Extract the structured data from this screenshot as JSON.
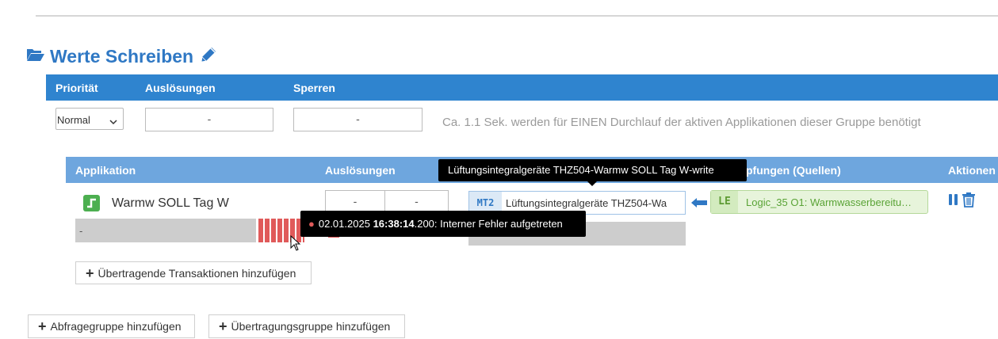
{
  "section": {
    "title": "Werte Schreiben",
    "icon": "folder-open-icon",
    "edit_icon": "pencil-icon"
  },
  "group_header": {
    "prioritaet": "Priorität",
    "ausloesungen": "Auslösungen",
    "sperren": "Sperren"
  },
  "group_values": {
    "priority_selected": "Normal",
    "ausloesungen": "-",
    "sperren": "-",
    "hint": "Ca. 1.1 Sek. werden für EINEN Durchlauf der aktiven Applikationen dieser Gruppe benötigt"
  },
  "app_header": {
    "applikation": "Applikation",
    "ausloesungen": "Auslösungen",
    "verknuepfungen": "pfungen (Quellen)",
    "aktionen": "Aktionen"
  },
  "app_row": {
    "name": "Warmw SOLL Tag W",
    "status_text": "-",
    "trigger_1": "-",
    "trigger_2": "-",
    "target_badge": "MT2",
    "target_name": "Lüftungsintegralgeräte THZ504-Wa",
    "source_badge": "LE",
    "source_name": "Logic_35 O1: Warmwasserbereitu…"
  },
  "tooltips": {
    "target_full": "Lüftungsintegralgeräte THZ504-Warmw SOLL Tag W-write",
    "error_date": "02.01.2025",
    "error_time": "16:38:14",
    "error_rest": ".200: Interner Fehler aufgetreten"
  },
  "buttons": {
    "add_transactions": "Übertragende Transaktionen hinzufügen",
    "add_query_group": "Abfragegruppe hinzufügen",
    "add_transfer_group": "Übertragungsgruppe hinzufügen"
  },
  "colors": {
    "header_blue": "#2f84cf",
    "sub_header_blue": "#6ea6de",
    "title_blue": "#2f78c4",
    "error_red": "#e05a5a",
    "green": "#4caf50"
  }
}
